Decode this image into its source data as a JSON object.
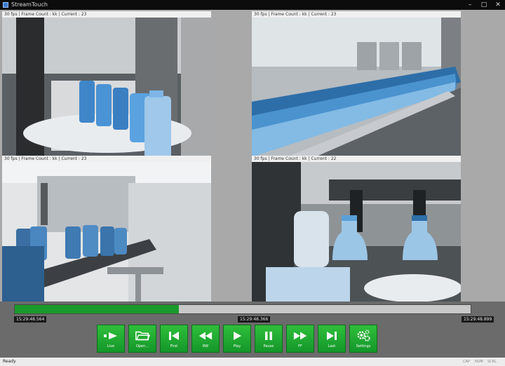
{
  "window": {
    "title": "StreamTouch"
  },
  "panes": [
    {
      "caption": "30 fps | Frame Count : kk | Current : 23"
    },
    {
      "caption": "30 fps | Frame Count : kk | Current : 23"
    },
    {
      "caption": "30 fps | Frame Count : kk | Current : 23"
    },
    {
      "caption": "30 fps | Frame Count : kk | Current : 22"
    }
  ],
  "timeline": {
    "progress_fraction": 0.36,
    "start_time": "15:29:48.564",
    "current_time": "15:29:48.366",
    "end_time": "15:29:48.899",
    "fill_color": "#1a9a2a"
  },
  "toolbar": {
    "buttons": [
      {
        "label": "Live",
        "icon": "live-icon"
      },
      {
        "label": "Open...",
        "icon": "folder-icon"
      },
      {
        "label": "First",
        "icon": "skip-first-icon"
      },
      {
        "label": "RW",
        "icon": "rewind-icon"
      },
      {
        "label": "Play",
        "icon": "play-icon"
      },
      {
        "label": "Pause",
        "icon": "pause-icon"
      },
      {
        "label": "FF",
        "icon": "fast-forward-icon"
      },
      {
        "label": "Last",
        "icon": "skip-last-icon"
      },
      {
        "label": "Settings",
        "icon": "gear-icon"
      }
    ],
    "accent_color": "#1fae2e"
  },
  "status": {
    "text": "Ready",
    "indicators": [
      "CAP",
      "NUM",
      "SCRL"
    ]
  }
}
